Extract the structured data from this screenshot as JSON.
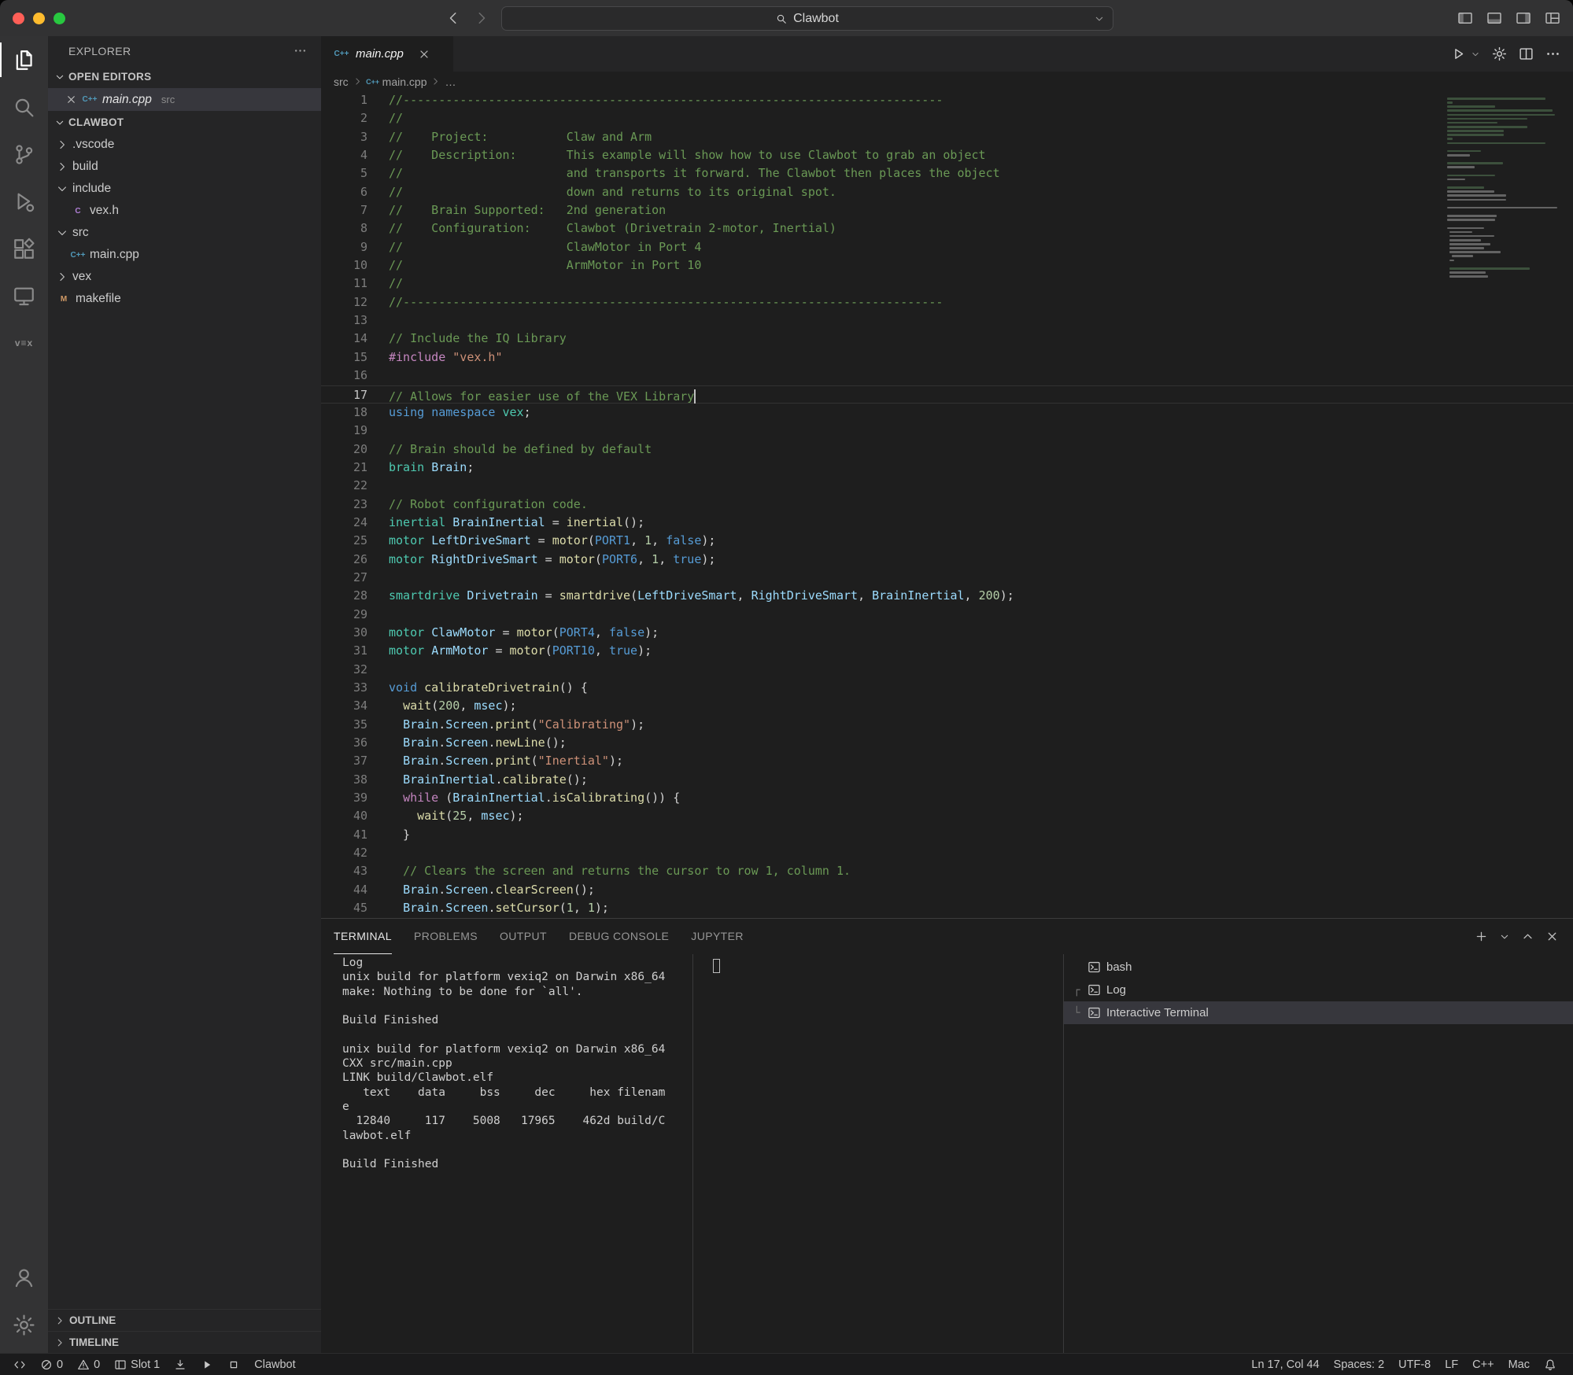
{
  "window": {
    "title_search": "Clawbot"
  },
  "colors": {
    "comment_green": "#6A9955",
    "keyword_blue": "#569CD6",
    "type_teal": "#4EC9B0",
    "variable_blue": "#9CDCFE",
    "function_yellow": "#DCDCAA",
    "string_orange": "#CE9178",
    "number_green": "#B5CEA8",
    "macro_purple": "#C586C0",
    "cpp_icon_blue": "#519aba",
    "traffic_red": "#ff5f57",
    "traffic_yellow": "#febc2e",
    "traffic_green": "#28c840",
    "selection_gray": "#37373d"
  },
  "activity_bar": {
    "items": [
      {
        "id": "explorer",
        "active": true
      },
      {
        "id": "search"
      },
      {
        "id": "source-control"
      },
      {
        "id": "run-debug"
      },
      {
        "id": "extensions"
      },
      {
        "id": "remote-explorer"
      },
      {
        "id": "vex",
        "label": "v≡x"
      }
    ],
    "bottom": [
      {
        "id": "accounts"
      },
      {
        "id": "settings"
      }
    ]
  },
  "sidebar": {
    "title": "EXPLORER",
    "open_editors": {
      "label": "OPEN EDITORS",
      "items": [
        {
          "name": "main.cpp",
          "detail": "src",
          "icon": "cpp",
          "selected": true
        }
      ]
    },
    "project": {
      "root": "CLAWBOT",
      "items": [
        {
          "label": ".vscode",
          "type": "folder",
          "expanded": false,
          "depth": 1
        },
        {
          "label": "build",
          "type": "folder",
          "expanded": false,
          "depth": 1
        },
        {
          "label": "include",
          "type": "folder",
          "expanded": true,
          "depth": 1
        },
        {
          "label": "vex.h",
          "type": "file",
          "icon": "c",
          "depth": 2
        },
        {
          "label": "src",
          "type": "folder",
          "expanded": true,
          "depth": 1
        },
        {
          "label": "main.cpp",
          "type": "file",
          "icon": "cpp",
          "depth": 2
        },
        {
          "label": "vex",
          "type": "folder",
          "expanded": false,
          "depth": 1
        },
        {
          "label": "makefile",
          "type": "file",
          "icon": "m",
          "depth": 1
        }
      ]
    },
    "bottom_sections": [
      {
        "label": "OUTLINE"
      },
      {
        "label": "TIMELINE"
      }
    ]
  },
  "editor": {
    "tabs": [
      {
        "label": "main.cpp",
        "icon": "cpp",
        "active": true,
        "preview": true
      }
    ],
    "breadcrumbs": [
      {
        "label": "src"
      },
      {
        "label": "main.cpp",
        "icon": "cpp"
      },
      {
        "label": "…"
      }
    ],
    "cursor": {
      "line": 17,
      "col": 44
    },
    "lines": [
      {
        "n": 1,
        "t": [
          [
            "c",
            "//----------------------------------------------------------------------------"
          ]
        ]
      },
      {
        "n": 2,
        "t": [
          [
            "c",
            "//"
          ]
        ]
      },
      {
        "n": 3,
        "t": [
          [
            "c",
            "//    Project:           Claw and Arm"
          ]
        ]
      },
      {
        "n": 4,
        "t": [
          [
            "c",
            "//    Description:       This example will show how to use Clawbot to grab an object"
          ]
        ]
      },
      {
        "n": 5,
        "t": [
          [
            "c",
            "//                       and transports it forward. The Clawbot then places the object"
          ]
        ]
      },
      {
        "n": 6,
        "t": [
          [
            "c",
            "//                       down and returns to its original spot."
          ]
        ]
      },
      {
        "n": 7,
        "t": [
          [
            "c",
            "//    Brain Supported:   2nd generation"
          ]
        ]
      },
      {
        "n": 8,
        "t": [
          [
            "c",
            "//    Configuration:     Clawbot (Drivetrain 2-motor, Inertial)"
          ]
        ]
      },
      {
        "n": 9,
        "t": [
          [
            "c",
            "//                       ClawMotor in Port 4"
          ]
        ]
      },
      {
        "n": 10,
        "t": [
          [
            "c",
            "//                       ArmMotor in Port 10"
          ]
        ]
      },
      {
        "n": 11,
        "t": [
          [
            "c",
            "//"
          ]
        ]
      },
      {
        "n": 12,
        "t": [
          [
            "c",
            "//----------------------------------------------------------------------------"
          ]
        ]
      },
      {
        "n": 13,
        "t": []
      },
      {
        "n": 14,
        "t": [
          [
            "c",
            "// Include the IQ Library"
          ]
        ]
      },
      {
        "n": 15,
        "t": [
          [
            "m",
            "#include"
          ],
          [
            "p",
            " "
          ],
          [
            "s",
            "\"vex.h\""
          ]
        ]
      },
      {
        "n": 16,
        "t": []
      },
      {
        "n": 17,
        "cur": true,
        "t": [
          [
            "c",
            "// Allows for easier use of the VEX Library"
          ]
        ]
      },
      {
        "n": 18,
        "t": [
          [
            "k",
            "using"
          ],
          [
            "p",
            " "
          ],
          [
            "k",
            "namespace"
          ],
          [
            "p",
            " "
          ],
          [
            "t2",
            "vex"
          ],
          [
            "p",
            ";"
          ]
        ]
      },
      {
        "n": 19,
        "t": []
      },
      {
        "n": 20,
        "t": [
          [
            "c",
            "// Brain should be defined by default"
          ]
        ]
      },
      {
        "n": 21,
        "t": [
          [
            "t2",
            "brain"
          ],
          [
            "p",
            " "
          ],
          [
            "v",
            "Brain"
          ],
          [
            "p",
            ";"
          ]
        ]
      },
      {
        "n": 22,
        "t": []
      },
      {
        "n": 23,
        "t": [
          [
            "c",
            "// Robot configuration code."
          ]
        ]
      },
      {
        "n": 24,
        "t": [
          [
            "t2",
            "inertial"
          ],
          [
            "p",
            " "
          ],
          [
            "v",
            "BrainInertial"
          ],
          [
            "p",
            " = "
          ],
          [
            "f",
            "inertial"
          ],
          [
            "p",
            "();"
          ]
        ]
      },
      {
        "n": 25,
        "t": [
          [
            "t2",
            "motor"
          ],
          [
            "p",
            " "
          ],
          [
            "v",
            "LeftDriveSmart"
          ],
          [
            "p",
            " = "
          ],
          [
            "f",
            "motor"
          ],
          [
            "p",
            "("
          ],
          [
            "k",
            "PORT1"
          ],
          [
            "p",
            ", "
          ],
          [
            "num",
            "1"
          ],
          [
            "p",
            ", "
          ],
          [
            "k",
            "false"
          ],
          [
            "p",
            ");"
          ]
        ]
      },
      {
        "n": 26,
        "t": [
          [
            "t2",
            "motor"
          ],
          [
            "p",
            " "
          ],
          [
            "v",
            "RightDriveSmart"
          ],
          [
            "p",
            " = "
          ],
          [
            "f",
            "motor"
          ],
          [
            "p",
            "("
          ],
          [
            "k",
            "PORT6"
          ],
          [
            "p",
            ", "
          ],
          [
            "num",
            "1"
          ],
          [
            "p",
            ", "
          ],
          [
            "k",
            "true"
          ],
          [
            "p",
            ");"
          ]
        ]
      },
      {
        "n": 27,
        "t": []
      },
      {
        "n": 28,
        "t": [
          [
            "t2",
            "smartdrive"
          ],
          [
            "p",
            " "
          ],
          [
            "v",
            "Drivetrain"
          ],
          [
            "p",
            " = "
          ],
          [
            "f",
            "smartdrive"
          ],
          [
            "p",
            "("
          ],
          [
            "v",
            "LeftDriveSmart"
          ],
          [
            "p",
            ", "
          ],
          [
            "v",
            "RightDriveSmart"
          ],
          [
            "p",
            ", "
          ],
          [
            "v",
            "BrainInertial"
          ],
          [
            "p",
            ", "
          ],
          [
            "num",
            "200"
          ],
          [
            "p",
            ");"
          ]
        ]
      },
      {
        "n": 29,
        "t": []
      },
      {
        "n": 30,
        "t": [
          [
            "t2",
            "motor"
          ],
          [
            "p",
            " "
          ],
          [
            "v",
            "ClawMotor"
          ],
          [
            "p",
            " = "
          ],
          [
            "f",
            "motor"
          ],
          [
            "p",
            "("
          ],
          [
            "k",
            "PORT4"
          ],
          [
            "p",
            ", "
          ],
          [
            "k",
            "false"
          ],
          [
            "p",
            ");"
          ]
        ]
      },
      {
        "n": 31,
        "t": [
          [
            "t2",
            "motor"
          ],
          [
            "p",
            " "
          ],
          [
            "v",
            "ArmMotor"
          ],
          [
            "p",
            " = "
          ],
          [
            "f",
            "motor"
          ],
          [
            "p",
            "("
          ],
          [
            "k",
            "PORT10"
          ],
          [
            "p",
            ", "
          ],
          [
            "k",
            "true"
          ],
          [
            "p",
            ");"
          ]
        ]
      },
      {
        "n": 32,
        "t": []
      },
      {
        "n": 33,
        "t": [
          [
            "k",
            "void"
          ],
          [
            "p",
            " "
          ],
          [
            "f",
            "calibrateDrivetrain"
          ],
          [
            "p",
            "() {"
          ]
        ]
      },
      {
        "n": 34,
        "t": [
          [
            "p",
            "  "
          ],
          [
            "f",
            "wait"
          ],
          [
            "p",
            "("
          ],
          [
            "num",
            "200"
          ],
          [
            "p",
            ", "
          ],
          [
            "v",
            "msec"
          ],
          [
            "p",
            ");"
          ]
        ]
      },
      {
        "n": 35,
        "t": [
          [
            "p",
            "  "
          ],
          [
            "v",
            "Brain"
          ],
          [
            "p",
            "."
          ],
          [
            "v",
            "Screen"
          ],
          [
            "p",
            "."
          ],
          [
            "f",
            "print"
          ],
          [
            "p",
            "("
          ],
          [
            "s",
            "\"Calibrating\""
          ],
          [
            "p",
            ");"
          ]
        ]
      },
      {
        "n": 36,
        "t": [
          [
            "p",
            "  "
          ],
          [
            "v",
            "Brain"
          ],
          [
            "p",
            "."
          ],
          [
            "v",
            "Screen"
          ],
          [
            "p",
            "."
          ],
          [
            "f",
            "newLine"
          ],
          [
            "p",
            "();"
          ]
        ]
      },
      {
        "n": 37,
        "t": [
          [
            "p",
            "  "
          ],
          [
            "v",
            "Brain"
          ],
          [
            "p",
            "."
          ],
          [
            "v",
            "Screen"
          ],
          [
            "p",
            "."
          ],
          [
            "f",
            "print"
          ],
          [
            "p",
            "("
          ],
          [
            "s",
            "\"Inertial\""
          ],
          [
            "p",
            ");"
          ]
        ]
      },
      {
        "n": 38,
        "t": [
          [
            "p",
            "  "
          ],
          [
            "v",
            "BrainInertial"
          ],
          [
            "p",
            "."
          ],
          [
            "f",
            "calibrate"
          ],
          [
            "p",
            "();"
          ]
        ]
      },
      {
        "n": 39,
        "t": [
          [
            "p",
            "  "
          ],
          [
            "ctl",
            "while"
          ],
          [
            "p",
            " ("
          ],
          [
            "v",
            "BrainInertial"
          ],
          [
            "p",
            "."
          ],
          [
            "f",
            "isCalibrating"
          ],
          [
            "p",
            "()) {"
          ]
        ]
      },
      {
        "n": 40,
        "t": [
          [
            "p",
            "    "
          ],
          [
            "f",
            "wait"
          ],
          [
            "p",
            "("
          ],
          [
            "num",
            "25"
          ],
          [
            "p",
            ", "
          ],
          [
            "v",
            "msec"
          ],
          [
            "p",
            ");"
          ]
        ]
      },
      {
        "n": 41,
        "t": [
          [
            "p",
            "  }"
          ]
        ]
      },
      {
        "n": 42,
        "t": []
      },
      {
        "n": 43,
        "t": [
          [
            "p",
            "  "
          ],
          [
            "c",
            "// Clears the screen and returns the cursor to row 1, column 1."
          ]
        ]
      },
      {
        "n": 44,
        "t": [
          [
            "p",
            "  "
          ],
          [
            "v",
            "Brain"
          ],
          [
            "p",
            "."
          ],
          [
            "v",
            "Screen"
          ],
          [
            "p",
            "."
          ],
          [
            "f",
            "clearScreen"
          ],
          [
            "p",
            "();"
          ]
        ]
      },
      {
        "n": 45,
        "t": [
          [
            "p",
            "  "
          ],
          [
            "v",
            "Brain"
          ],
          [
            "p",
            "."
          ],
          [
            "v",
            "Screen"
          ],
          [
            "p",
            "."
          ],
          [
            "f",
            "setCursor"
          ],
          [
            "p",
            "("
          ],
          [
            "num",
            "1"
          ],
          [
            "p",
            ", "
          ],
          [
            "num",
            "1"
          ],
          [
            "p",
            ");"
          ]
        ]
      }
    ]
  },
  "panel": {
    "tabs": [
      {
        "label": "TERMINAL",
        "active": true
      },
      {
        "label": "PROBLEMS"
      },
      {
        "label": "OUTPUT"
      },
      {
        "label": "DEBUG CONSOLE"
      },
      {
        "label": "JUPYTER"
      }
    ],
    "terminal_output": [
      "Log",
      "unix build for platform vexiq2 on Darwin x86_64",
      "make: Nothing to be done for `all'.",
      "",
      "Build Finished",
      "",
      "unix build for platform vexiq2 on Darwin x86_64",
      "CXX src/main.cpp",
      "LINK build/Clawbot.elf",
      "   text    data     bss     dec     hex filenam",
      "e",
      "  12840     117    5008   17965    462d build/C",
      "lawbot.elf",
      "",
      "Build Finished"
    ],
    "terminals": [
      {
        "label": "bash",
        "connector": ""
      },
      {
        "label": "Log",
        "connector": "┌"
      },
      {
        "label": "Interactive Terminal",
        "connector": "└",
        "selected": true
      }
    ]
  },
  "status_bar": {
    "left": [
      {
        "id": "remote",
        "icon": "remote"
      },
      {
        "id": "errors",
        "icon": "error",
        "text": "0"
      },
      {
        "id": "warnings",
        "icon": "warning",
        "text": "0"
      },
      {
        "id": "slot",
        "icon": "slot",
        "text": "Slot 1"
      },
      {
        "id": "download-to-brain",
        "icon": "download"
      },
      {
        "id": "run-program",
        "icon": "play-solid"
      },
      {
        "id": "stop-program",
        "icon": "stop"
      },
      {
        "id": "project-name",
        "text": "Clawbot"
      }
    ],
    "right": [
      {
        "id": "cursor-position",
        "text": "Ln 17, Col 44"
      },
      {
        "id": "indentation",
        "text": "Spaces: 2"
      },
      {
        "id": "encoding",
        "text": "UTF-8"
      },
      {
        "id": "eol",
        "text": "LF"
      },
      {
        "id": "language-mode",
        "text": "C++"
      },
      {
        "id": "platform-target",
        "text": "Mac"
      },
      {
        "id": "notifications",
        "icon": "bell"
      }
    ]
  }
}
